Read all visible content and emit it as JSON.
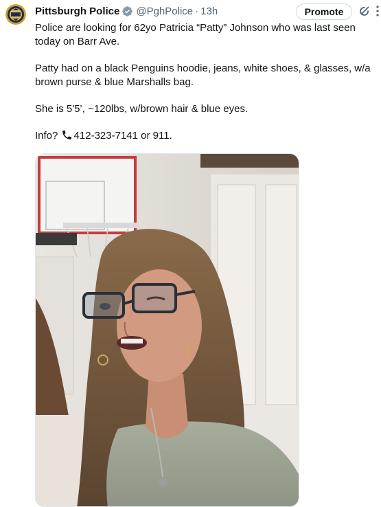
{
  "tweet": {
    "author_name": "Pittsburgh Police",
    "handle": "@PghPolice",
    "separator": "·",
    "time": "13h",
    "promote_label": "Promote",
    "paragraphs": [
      "Police are looking for 62yo Patricia “Patty” Johnson who was last seen today on Barr Ave.",
      "Patty had on a black Penguins hoodie, jeans, white shoes, & glasses, w/a brown purse & blue Marshalls bag.",
      "She is 5'5’, ~120lbs, w/brown hair & blue eyes."
    ],
    "info_prefix": "Info?",
    "info_text": "412-323-7141 or 911."
  },
  "icons": {
    "avatar": "police-badge-icon",
    "verified": "verified-badge-icon",
    "grok": "grok-icon",
    "more": "more-icon",
    "phone": "phone-icon"
  },
  "colors": {
    "text": "#0f1419",
    "secondary_text": "#536471",
    "verified_gray": "#829aab",
    "avatar_gold": "#c9a227",
    "avatar_navy": "#1f2a5a"
  }
}
